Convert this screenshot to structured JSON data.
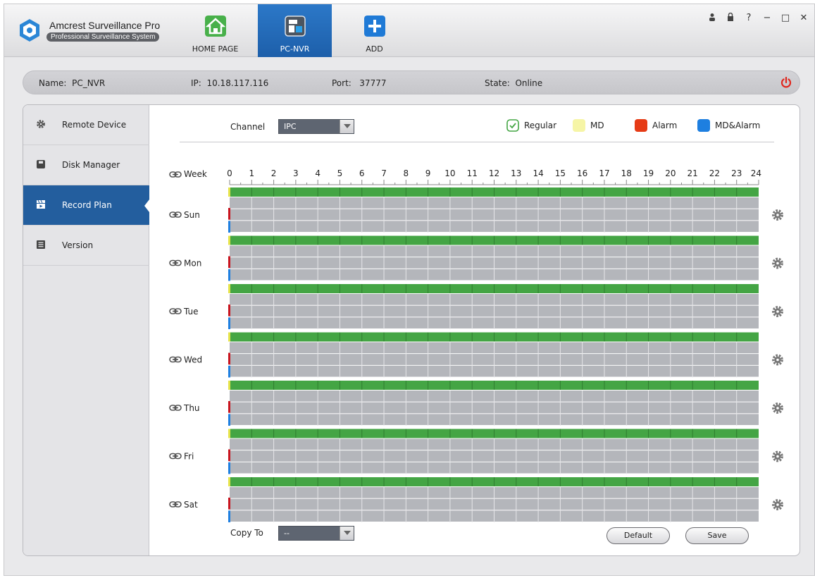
{
  "app": {
    "title": "Amcrest Surveillance Pro",
    "subtitle": "Professional Surveillance System"
  },
  "nav_tabs": [
    {
      "label": "HOME PAGE",
      "icon": "home-icon"
    },
    {
      "label": "PC-NVR",
      "icon": "pc-nvr-icon",
      "active": true
    },
    {
      "label": "ADD",
      "icon": "add-icon"
    }
  ],
  "window_controls": {
    "user": "user-icon",
    "lock": "lock-icon",
    "help": "?",
    "minimize": "−",
    "maximize": "□",
    "close": "✕"
  },
  "device": {
    "name_label": "Name:",
    "name": "PC_NVR",
    "ip_label": "IP:",
    "ip": "10.18.117.116",
    "port_label": "Port:",
    "port": "37777",
    "state_label": "State:",
    "state": "Online"
  },
  "sidebar": {
    "items": [
      {
        "label": "Remote Device",
        "icon": "gear-icon"
      },
      {
        "label": "Disk Manager",
        "icon": "disk-icon"
      },
      {
        "label": "Record Plan",
        "icon": "clapperboard-icon",
        "active": true
      },
      {
        "label": "Version",
        "icon": "document-icon"
      }
    ]
  },
  "record_plan": {
    "channel_label": "Channel",
    "channel_value": "IPC",
    "legend": [
      {
        "label": "Regular",
        "color": "#44a544",
        "checked": true
      },
      {
        "label": "MD",
        "color": "#f6f5a6"
      },
      {
        "label": "Alarm",
        "color": "#e63b16"
      },
      {
        "label": "MD&Alarm",
        "color": "#1e7fe0"
      }
    ],
    "week_label": "Week",
    "hours": [
      "0",
      "1",
      "2",
      "3",
      "4",
      "5",
      "6",
      "7",
      "8",
      "9",
      "10",
      "11",
      "12",
      "13",
      "14",
      "15",
      "16",
      "17",
      "18",
      "19",
      "20",
      "21",
      "22",
      "23",
      "24"
    ],
    "days": [
      "Sun",
      "Mon",
      "Tue",
      "Wed",
      "Thu",
      "Fri",
      "Sat"
    ],
    "regular_coverage": 1.0,
    "copy_to_label": "Copy To",
    "copy_to_value": "--",
    "default_label": "Default",
    "save_label": "Save"
  },
  "colors": {
    "accent": "#235e9e",
    "regular": "#44a544",
    "md": "#e5e34a",
    "alarm": "#c8141e",
    "md_alarm": "#1e7fe0",
    "grid_bg": "#b4b6bb"
  }
}
